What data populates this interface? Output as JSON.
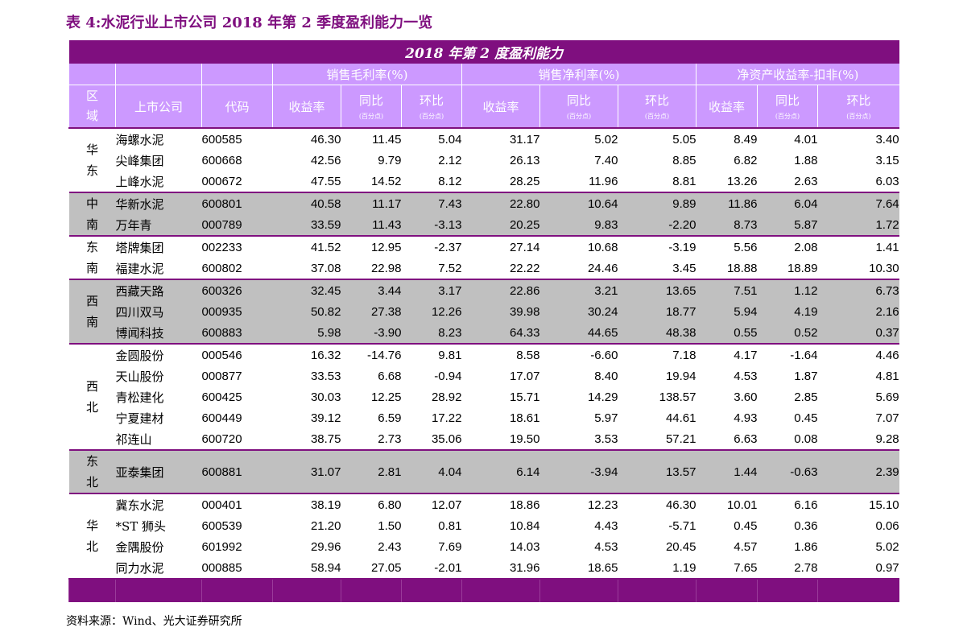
{
  "title": "表 4:水泥行业上市公司 2018 年第 2 季度盈利能力一览",
  "banner": "2018 年第 2 度盈利能力",
  "group_headers": {
    "gross_margin": "销售毛利率(%)",
    "net_margin": "销售净利率(%)",
    "roe": "净资产收益率-扣非(%)"
  },
  "column_headers": {
    "region": "区域",
    "company": "上市公司",
    "code": "代码",
    "rate": "收益率",
    "yoy": "同比",
    "qoq": "环比",
    "unit": "(百分点)"
  },
  "regions": [
    {
      "name": "华东",
      "rows": [
        [
          "海螺水泥",
          "600585",
          "46.30",
          "11.45",
          "5.04",
          "31.17",
          "5.02",
          "5.05",
          "8.49",
          "4.01",
          "3.40"
        ],
        [
          "尖峰集团",
          "600668",
          "42.56",
          "9.79",
          "2.12",
          "26.13",
          "7.40",
          "8.85",
          "6.82",
          "1.88",
          "3.15"
        ],
        [
          "上峰水泥",
          "000672",
          "47.55",
          "14.52",
          "8.12",
          "28.25",
          "11.96",
          "8.81",
          "13.26",
          "2.63",
          "6.03"
        ]
      ]
    },
    {
      "name": "中南",
      "rows": [
        [
          "华新水泥",
          "600801",
          "40.58",
          "11.17",
          "7.43",
          "22.80",
          "10.64",
          "9.89",
          "11.86",
          "6.04",
          "7.64"
        ],
        [
          "万年青",
          "000789",
          "33.59",
          "11.43",
          "-3.13",
          "20.25",
          "9.83",
          "-2.20",
          "8.73",
          "5.87",
          "1.72"
        ]
      ]
    },
    {
      "name": "东南",
      "rows": [
        [
          "塔牌集团",
          "002233",
          "41.52",
          "12.95",
          "-2.37",
          "27.14",
          "10.68",
          "-3.19",
          "5.56",
          "2.08",
          "1.41"
        ],
        [
          "福建水泥",
          "600802",
          "37.08",
          "22.98",
          "7.52",
          "22.22",
          "24.46",
          "3.45",
          "18.88",
          "18.89",
          "10.30"
        ]
      ]
    },
    {
      "name": "西南",
      "rows": [
        [
          "西藏天路",
          "600326",
          "32.45",
          "3.44",
          "3.17",
          "22.86",
          "3.21",
          "13.65",
          "7.51",
          "1.12",
          "6.73"
        ],
        [
          "四川双马",
          "000935",
          "50.82",
          "27.38",
          "12.26",
          "39.98",
          "30.24",
          "18.77",
          "5.94",
          "4.19",
          "2.16"
        ],
        [
          "博闻科技",
          "600883",
          "5.98",
          "-3.90",
          "8.23",
          "64.33",
          "44.65",
          "48.38",
          "0.55",
          "0.52",
          "0.37"
        ]
      ]
    },
    {
      "name": "西北",
      "rows": [
        [
          "金圆股份",
          "000546",
          "16.32",
          "-14.76",
          "9.81",
          "8.58",
          "-6.60",
          "7.18",
          "4.17",
          "-1.64",
          "4.46"
        ],
        [
          "天山股份",
          "000877",
          "33.53",
          "6.68",
          "-0.94",
          "17.07",
          "8.40",
          "19.94",
          "4.53",
          "1.87",
          "4.81"
        ],
        [
          "青松建化",
          "600425",
          "30.03",
          "12.25",
          "28.92",
          "15.71",
          "14.29",
          "138.57",
          "3.60",
          "2.85",
          "5.69"
        ],
        [
          "宁夏建材",
          "600449",
          "39.12",
          "6.59",
          "17.22",
          "18.61",
          "5.97",
          "44.61",
          "4.93",
          "0.45",
          "7.07"
        ],
        [
          "祁连山",
          "600720",
          "38.75",
          "2.73",
          "35.06",
          "19.50",
          "3.53",
          "57.21",
          "6.63",
          "0.08",
          "9.28"
        ]
      ]
    },
    {
      "name": "东北",
      "rows": [
        [
          "亚泰集团",
          "600881",
          "31.07",
          "2.81",
          "4.04",
          "6.14",
          "-3.94",
          "13.57",
          "1.44",
          "-0.63",
          "2.39"
        ]
      ]
    },
    {
      "name": "华北",
      "rows": [
        [
          "冀东水泥",
          "000401",
          "38.19",
          "6.80",
          "12.07",
          "18.86",
          "12.23",
          "46.30",
          "10.01",
          "6.16",
          "15.10"
        ],
        [
          "*ST 狮头",
          "600539",
          "21.20",
          "1.50",
          "0.81",
          "10.84",
          "4.43",
          "-5.71",
          "0.45",
          "0.36",
          "0.06"
        ],
        [
          "金隅股份",
          "601992",
          "29.96",
          "2.43",
          "7.69",
          "14.03",
          "4.53",
          "20.45",
          "4.57",
          "1.86",
          "5.02"
        ],
        [
          "同力水泥",
          "000885",
          "58.94",
          "27.05",
          "-2.01",
          "31.96",
          "18.65",
          "1.19",
          "7.65",
          "2.78",
          "0.97"
        ]
      ]
    }
  ],
  "source": "资料来源：Wind、光大证券研究所",
  "colors": {
    "banner": "#7f0f7f",
    "header": "#cc99ff",
    "shaded_row": "#c0c0c0",
    "title": "#7f0f7f"
  }
}
